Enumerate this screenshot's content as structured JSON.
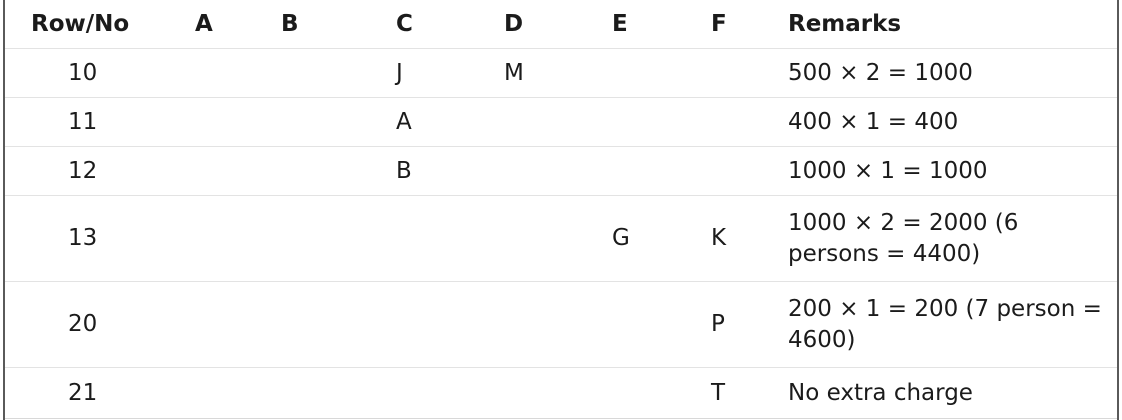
{
  "table": {
    "headers": {
      "row": "Row/No",
      "a": "A",
      "b": "B",
      "c": "C",
      "d": "D",
      "e": "E",
      "f": "F",
      "remarks": "Remarks"
    },
    "rows": [
      {
        "row": "10",
        "a": "",
        "b": "",
        "c": "J",
        "d": "M",
        "e": "",
        "f": "",
        "remarks": "500 × 2 = 1000"
      },
      {
        "row": "11",
        "a": "",
        "b": "",
        "c": "A",
        "d": "",
        "e": "",
        "f": "",
        "remarks": "400 × 1 = 400"
      },
      {
        "row": "12",
        "a": "",
        "b": "",
        "c": "B",
        "d": "",
        "e": "",
        "f": "",
        "remarks": "1000 × 1 = 1000"
      },
      {
        "row": "13",
        "a": "",
        "b": "",
        "c": "",
        "d": "",
        "e": "G",
        "f": "K",
        "remarks": "1000 × 2 = 2000 (6 persons = 4400)"
      },
      {
        "row": "20",
        "a": "",
        "b": "",
        "c": "",
        "d": "",
        "e": "",
        "f": "P",
        "remarks": "200 × 1 = 200 (7 person = 4600)"
      },
      {
        "row": "21",
        "a": "",
        "b": "",
        "c": "",
        "d": "",
        "e": "",
        "f": "T",
        "remarks": "No extra charge"
      }
    ]
  }
}
